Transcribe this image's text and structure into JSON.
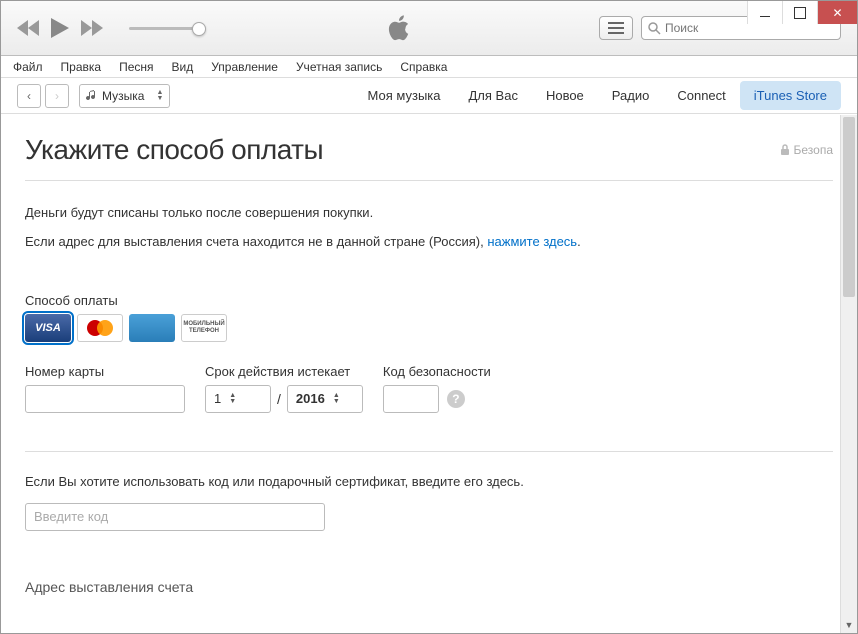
{
  "search": {
    "placeholder": "Поиск"
  },
  "menubar": [
    "Файл",
    "Правка",
    "Песня",
    "Вид",
    "Управление",
    "Учетная запись",
    "Справка"
  ],
  "library": {
    "selected": "Музыка"
  },
  "tabs": {
    "items": [
      "Моя музыка",
      "Для Вас",
      "Новое",
      "Радио",
      "Connect",
      "iTunes Store"
    ],
    "active_index": 5
  },
  "page": {
    "title": "Укажите способ оплаты",
    "secure": "Безопа",
    "desc1": "Деньги будут списаны только после совершения покупки.",
    "desc2_prefix": "Если адрес для выставления счета находится не в данной стране (Россия), ",
    "desc2_link": "нажмите здесь",
    "desc2_suffix": "."
  },
  "payment": {
    "method_label": "Способ оплаты",
    "cards": {
      "visa": "VISA",
      "mastercard": "MasterCard",
      "amex": "AMEX",
      "mobile": "МОБИЛЬНЫЙ ТЕЛЕФОН"
    },
    "card_number_label": "Номер карты",
    "expiry_label": "Срок действия истекает",
    "expiry_month": "1",
    "expiry_year": "2016",
    "security_label": "Код безопасности"
  },
  "gift": {
    "desc": "Если Вы хотите использовать код или подарочный сертификат, введите его здесь.",
    "placeholder": "Введите код"
  },
  "billing": {
    "header": "Адрес выставления счета"
  }
}
